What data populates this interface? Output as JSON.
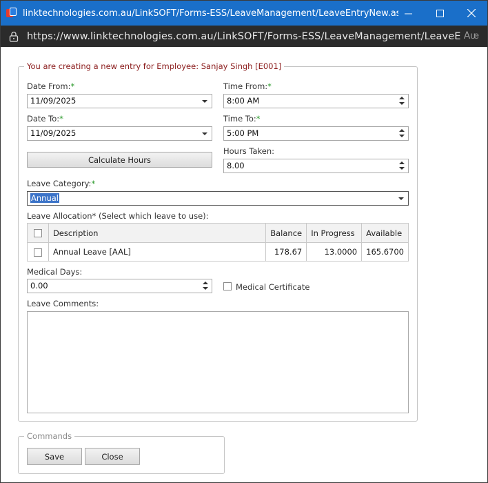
{
  "window": {
    "title": "linktechnologies.com.au/LinkSOFT/Forms-ESS/LeaveManagement/LeaveEntryNew.aspx?ID=&Popu...",
    "url": "https://www.linktechnologies.com.au/LinkSOFT/Forms-ESS/LeaveManagement/LeaveEntryNew.aspx...",
    "read_aloud": "Aᵫ",
    "title_bg": "#1a6fc9"
  },
  "form": {
    "legend": "You are creating a new entry for Employee: Sanjay Singh [E001]",
    "legend_color": "#8a1a1a",
    "required_mark": "*",
    "date_from": {
      "label": "Date From:",
      "value": "11/09/2025"
    },
    "date_to": {
      "label": "Date To:",
      "value": "11/09/2025"
    },
    "time_from": {
      "label": "Time From:",
      "value": "8:00 AM"
    },
    "time_to": {
      "label": "Time To:",
      "value": "5:00 PM"
    },
    "hours_taken": {
      "label": "Hours Taken:",
      "value": "8.00"
    },
    "calculate_label": "Calculate Hours",
    "leave_category": {
      "label": "Leave Category:",
      "value": "Annual"
    },
    "allocation_label": "Leave Allocation* (Select which leave to use):",
    "allocation": {
      "headers": [
        "Description",
        "Balance",
        "In Progress",
        "Available"
      ],
      "rows": [
        {
          "description": "Annual Leave [AAL]",
          "balance": "178.67",
          "in_progress": "13.0000",
          "available": "165.6700"
        }
      ]
    },
    "medical_days": {
      "label": "Medical Days:",
      "value": "0.00"
    },
    "medical_certificate_label": "Medical Certificate",
    "comments_label": "Leave Comments:"
  },
  "commands": {
    "legend": "Commands",
    "save_label": "Save",
    "close_label": "Close"
  }
}
